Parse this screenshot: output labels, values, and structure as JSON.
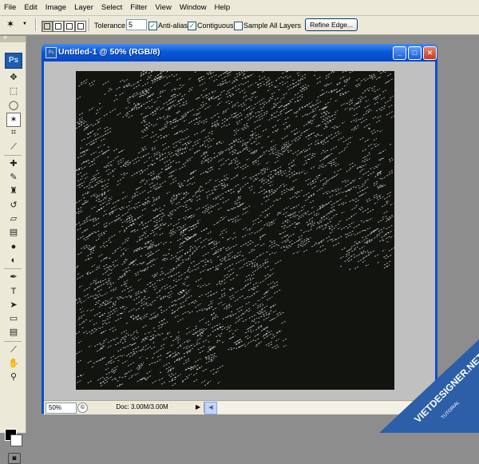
{
  "menu": [
    "File",
    "Edit",
    "Image",
    "Layer",
    "Select",
    "Filter",
    "View",
    "Window",
    "Help"
  ],
  "options": {
    "tolerance_label": "Tolerance:",
    "tolerance_value": "5",
    "anti_alias": "Anti-alias",
    "contiguous": "Contiguous",
    "sample_all_layers": "Sample All Layers",
    "refine_edge": "Refine Edge...",
    "check": "✓"
  },
  "toolbar": {
    "logo": "Ps",
    "collapse": "»",
    "tools": [
      {
        "name": "move-tool-icon",
        "glyph": "✥"
      },
      {
        "name": "marquee-tool-icon",
        "glyph": "⬚"
      },
      {
        "name": "lasso-tool-icon",
        "glyph": "◯"
      },
      {
        "name": "magic-wand-tool-icon",
        "glyph": "✶"
      },
      {
        "name": "crop-tool-icon",
        "glyph": "⌗"
      },
      {
        "name": "eyedropper-slice-tool-icon",
        "glyph": "⟋"
      },
      {
        "name": "healing-brush-tool-icon",
        "glyph": "✚"
      },
      {
        "name": "brush-tool-icon",
        "glyph": "✎"
      },
      {
        "name": "clone-stamp-tool-icon",
        "glyph": "♜"
      },
      {
        "name": "history-brush-tool-icon",
        "glyph": "↺"
      },
      {
        "name": "eraser-tool-icon",
        "glyph": "▱"
      },
      {
        "name": "gradient-tool-icon",
        "glyph": "▤"
      },
      {
        "name": "blur-tool-icon",
        "glyph": "●"
      },
      {
        "name": "dodge-tool-icon",
        "glyph": "◐"
      },
      {
        "name": "pen-tool-icon",
        "glyph": "✒"
      },
      {
        "name": "type-tool-icon",
        "glyph": "T"
      },
      {
        "name": "path-selection-tool-icon",
        "glyph": "➤"
      },
      {
        "name": "shape-tool-icon",
        "glyph": "▭"
      },
      {
        "name": "notes-tool-icon",
        "glyph": "▤"
      },
      {
        "name": "eyedropper-tool-icon",
        "glyph": "⟋"
      },
      {
        "name": "hand-tool-icon",
        "glyph": "✋"
      },
      {
        "name": "zoom-tool-icon",
        "glyph": "⚲"
      }
    ],
    "mask_glyph": "◙"
  },
  "document": {
    "title": "Untitled-1 @ 50% (RGB/8)",
    "icon_text": "Ps",
    "minimize": "_",
    "maximize": "□",
    "close": "✕"
  },
  "status": {
    "zoom": "50%",
    "doc_info": "Doc: 3.00M/3.00M",
    "arrow": "▶",
    "icon": "©",
    "scroll_left": "◀",
    "scroll_right": "▶"
  },
  "watermark": {
    "brand": "VIETDESIGNER.NET",
    "sub": "TUTORIAL"
  },
  "colors": {
    "title_bar": "#0a58d8",
    "canvas": "#121410",
    "workspace": "#c0c0c0",
    "watermark": "#2c5fa8"
  }
}
